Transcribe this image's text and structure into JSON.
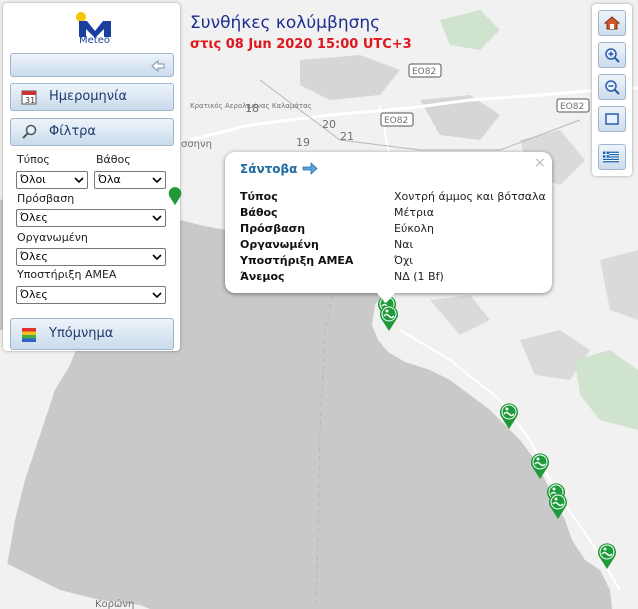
{
  "header": {
    "title": "Συνθήκες κολύμβησης",
    "subtitle": "στις 08 Jun 2020 15:00 UTC+3"
  },
  "logo": {
    "text": "Meteo"
  },
  "panel": {
    "date_button": "Ημερομηνία",
    "filters_button": "Φίλτρα",
    "legend_button": "Υπόμνημα",
    "filters": {
      "type": {
        "label": "Τύπος",
        "value": "Όλοι"
      },
      "depth": {
        "label": "Βάθος",
        "value": "Όλα"
      },
      "access": {
        "label": "Πρόσβαση",
        "value": "Όλες"
      },
      "organized": {
        "label": "Οργανωμένη",
        "value": "Όλες"
      },
      "amea": {
        "label": "Υποστήριξη ΑΜΕΑ",
        "value": "Όλες"
      }
    }
  },
  "toolbar": {
    "icons": [
      "home-icon",
      "zoom-in-icon",
      "zoom-out-icon",
      "fullscreen-icon",
      "greek-flag-icon"
    ]
  },
  "popup": {
    "title": "Σάντοβα",
    "close": "×",
    "rows": [
      {
        "key": "Τύπος",
        "value": "Χοντρή άμμος και βότσαλα"
      },
      {
        "key": "Βάθος",
        "value": "Μέτρια"
      },
      {
        "key": "Πρόσβαση",
        "value": "Εύκολη"
      },
      {
        "key": "Οργανωμένη",
        "value": "Ναι"
      },
      {
        "key": "Υποστήριξη ΑΜΕΑ",
        "value": "Όχι"
      },
      {
        "key": "Άνεμος",
        "value": "ΝΔ (1 Bf)"
      }
    ]
  },
  "map": {
    "road_labels": [
      "ΕΟ82",
      "ΕΟ82",
      "ΕΟ82"
    ],
    "km_labels": [
      "18",
      "19",
      "20",
      "21"
    ],
    "place_labels": [
      "Κρατικός Αερολιμένας Καλαμάτας",
      "σσηνη",
      "Κορώνη"
    ],
    "colors": {
      "land": "#f0f0f0",
      "sea": "#c9c9c9",
      "marker": "#1f9a3a",
      "title": "#1d2e8f",
      "subtitle": "#e0161c"
    }
  }
}
